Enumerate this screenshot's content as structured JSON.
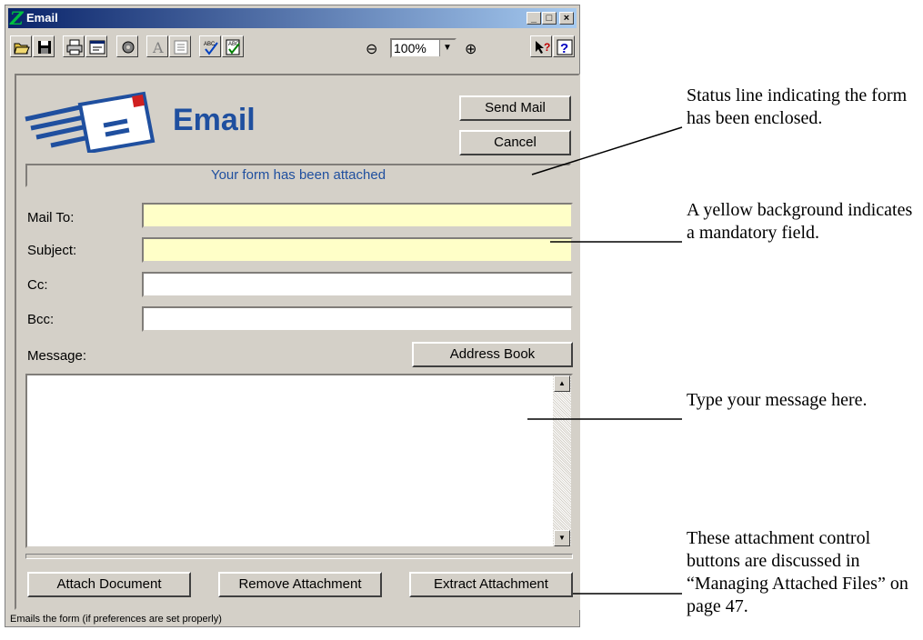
{
  "window": {
    "title": "Email"
  },
  "title_buttons": {
    "minimize": "_",
    "maximize": "□",
    "close": "×"
  },
  "toolbar": {
    "icons": [
      "open-icon",
      "save-icon",
      "print-icon",
      "form-icon",
      "settings-icon",
      "font-icon",
      "text-format-icon",
      "spellcheck-icon",
      "spellcheck-form-icon",
      "zoom-out-icon",
      "zoom-in-icon",
      "whats-this-icon",
      "help-icon"
    ],
    "zoom_value": "100%",
    "zoom_out": "⊖",
    "zoom_in": "⊕"
  },
  "header": {
    "title": "Email",
    "title_color": "#1f4f9f"
  },
  "buttons": {
    "send": "Send Mail",
    "cancel": "Cancel",
    "address_book": "Address Book",
    "attach": "Attach Document",
    "remove": "Remove Attachment",
    "extract": "Extract Attachment"
  },
  "status_line": "Your form has been attached",
  "fields": {
    "mail_to": {
      "label": "Mail To:",
      "value": "",
      "required": true
    },
    "subject": {
      "label": "Subject:",
      "value": "",
      "required": true
    },
    "cc": {
      "label": "Cc:",
      "value": ""
    },
    "bcc": {
      "label": "Bcc:",
      "value": ""
    },
    "message": {
      "label": "Message:",
      "value": ""
    }
  },
  "statusbar": "Emails the form (if preferences are set properly)",
  "annotations": {
    "status": "Status line indicating the form has been enclosed.",
    "yellow": "A yellow background indicates a mandatory field.",
    "message": "Type your message here.",
    "attachments": "These attachment control buttons are discussed in “Managing Attached Files” on page 47."
  },
  "colors": {
    "required_bg": "#ffffc8",
    "titlebar_start": "#0a246a",
    "titlebar_end": "#a6caf0"
  }
}
